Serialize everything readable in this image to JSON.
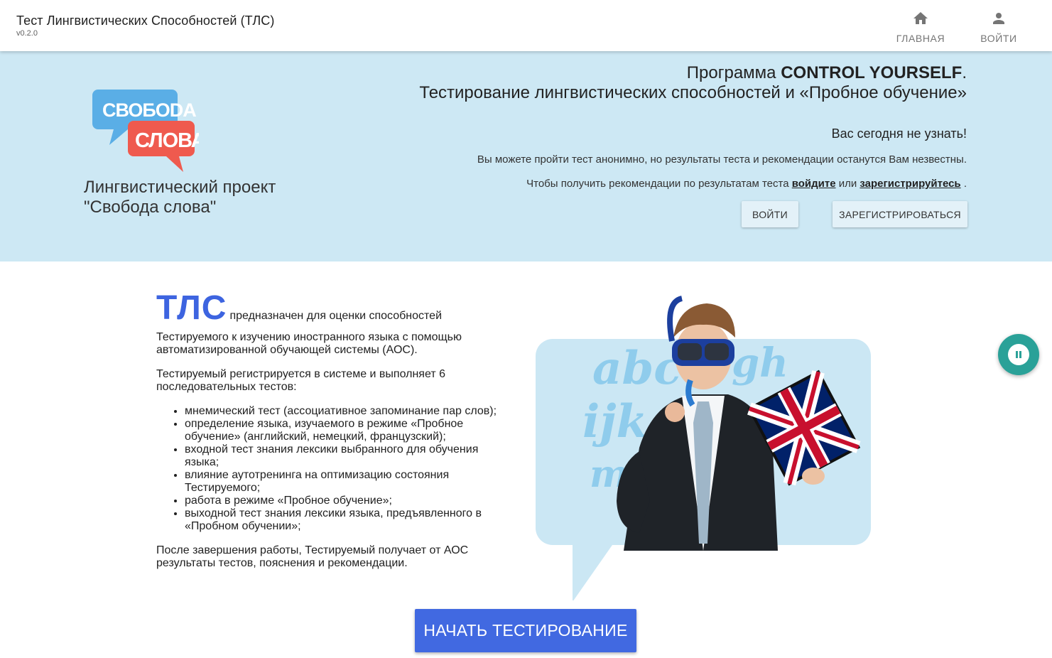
{
  "appbar": {
    "title": "Тест Лингвистических Способностей (ТЛС)",
    "version": "v0.2.0",
    "nav": {
      "home_label": "ГЛАВНАЯ",
      "home_icon": "home-icon",
      "login_label": "ВОЙТИ",
      "login_icon": "person-icon"
    }
  },
  "hero": {
    "logo": {
      "top_text": "СВОБОDA",
      "bottom_text": "СЛОВА"
    },
    "project_name": "Лингвистический проект\n\"Свобода слова\"",
    "program_prefix": "Программа ",
    "program_name": "CONTROL YOURSELF",
    "program_suffix": ".",
    "subtitle": "Тестирование лингвистических способностей и «Пробное обучение»",
    "greeting": "Вас сегодня не узнать!",
    "anon_note": "Вы можете пройти тест анонимно, но результаты теста и рекомендации останутся Вам незвестны.",
    "reco_prefix": "Чтобы получить рекомендации по результатам теста ",
    "reco_login_link": "войдите",
    "reco_middle": " или ",
    "reco_register_link": "зарегистрируйтесь",
    "reco_suffix": " .",
    "login_button": "ВОЙТИ",
    "register_button": "ЗАРЕГИСТРИРОВАТЬСЯ",
    "background_color": "#cde8f4"
  },
  "main": {
    "tls_title": "ТЛС",
    "intro_tail": "предназначен для оценки способностей",
    "intro_rest": "Тестируемого к изучению иностранного языка с помощью автоматизированной обучающей системы (АОС).",
    "register_para": "Тестируемый регистрируется в системе и выполняет 6 последовательных тестов:",
    "tests": [
      "мнемический тест (ассоциативное запоминание пар слов);",
      "определение языка, изучаемого в режиме «Пробное обучение» (английский, немецкий, французский);",
      "входной тест знания лексики выбранного для обучения языка;",
      "влияние аутотренинга на оптимизацию состояния Тестируемого;",
      "работа в режиме «Пробное обучение»;",
      "выходной тест знания лексики языка, предъявленного в «Пробном обучении»;"
    ],
    "outro_para": "После завершения работы, Тестируемый получает от АОС результаты тестов, пояснения и рекомендации.",
    "start_button": "НАЧАТЬ ТЕСТИРОВАНИЕ",
    "accent_color": "#4169e1"
  },
  "fab": {
    "icon": "pause-icon",
    "color": "#2aa198"
  }
}
